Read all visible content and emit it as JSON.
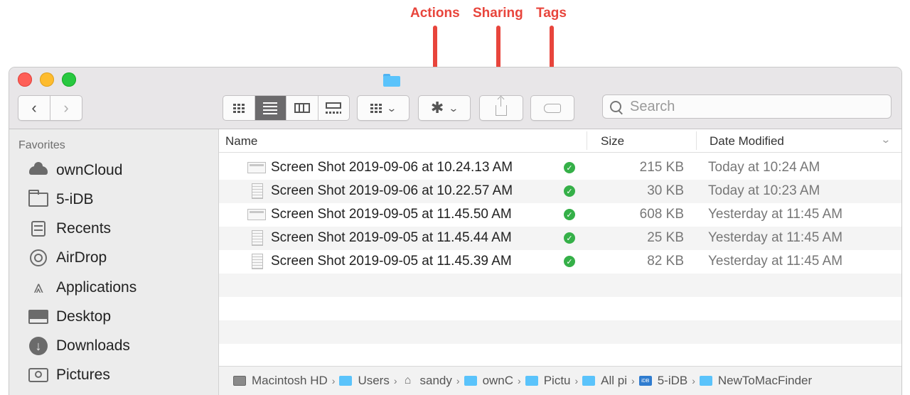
{
  "annotations": [
    {
      "label": "Actions"
    },
    {
      "label": "Sharing"
    },
    {
      "label": "Tags"
    }
  ],
  "toolbar": {
    "search_placeholder": "Search"
  },
  "sidebar": {
    "heading": "Favorites",
    "items": [
      {
        "label": "ownCloud",
        "icon": "cloud-icon"
      },
      {
        "label": "5-iDB",
        "icon": "folder-icon"
      },
      {
        "label": "Recents",
        "icon": "recents-icon"
      },
      {
        "label": "AirDrop",
        "icon": "airdrop-icon"
      },
      {
        "label": "Applications",
        "icon": "applications-icon"
      },
      {
        "label": "Desktop",
        "icon": "desktop-icon"
      },
      {
        "label": "Downloads",
        "icon": "downloads-icon"
      },
      {
        "label": "Pictures",
        "icon": "pictures-icon"
      }
    ]
  },
  "columns": {
    "name": "Name",
    "size": "Size",
    "date": "Date Modified"
  },
  "files": [
    {
      "name": "Screen Shot 2019-09-06 at 10.24.13 AM",
      "size": "215 KB",
      "date": "Today at 10:24 AM"
    },
    {
      "name": "Screen Shot 2019-09-06 at 10.22.57 AM",
      "size": "30 KB",
      "date": "Today at 10:23 AM"
    },
    {
      "name": "Screen Shot 2019-09-05 at 11.45.50 AM",
      "size": "608 KB",
      "date": "Yesterday at 11:45 AM"
    },
    {
      "name": "Screen Shot 2019-09-05 at 11.45.44 AM",
      "size": "25 KB",
      "date": "Yesterday at 11:45 AM"
    },
    {
      "name": "Screen Shot 2019-09-05 at 11.45.39 AM",
      "size": "82 KB",
      "date": "Yesterday at 11:45 AM"
    }
  ],
  "pathbar": [
    {
      "label": "Macintosh HD"
    },
    {
      "label": "Users"
    },
    {
      "label": "sandy"
    },
    {
      "label": "ownC"
    },
    {
      "label": "Pictu"
    },
    {
      "label": "All pi"
    },
    {
      "label": "5-iDB"
    },
    {
      "label": "NewToMacFinder"
    }
  ],
  "colors": {
    "annotation": "#e8453c",
    "sync_ok": "#35b048",
    "folder": "#5ac3fb"
  }
}
